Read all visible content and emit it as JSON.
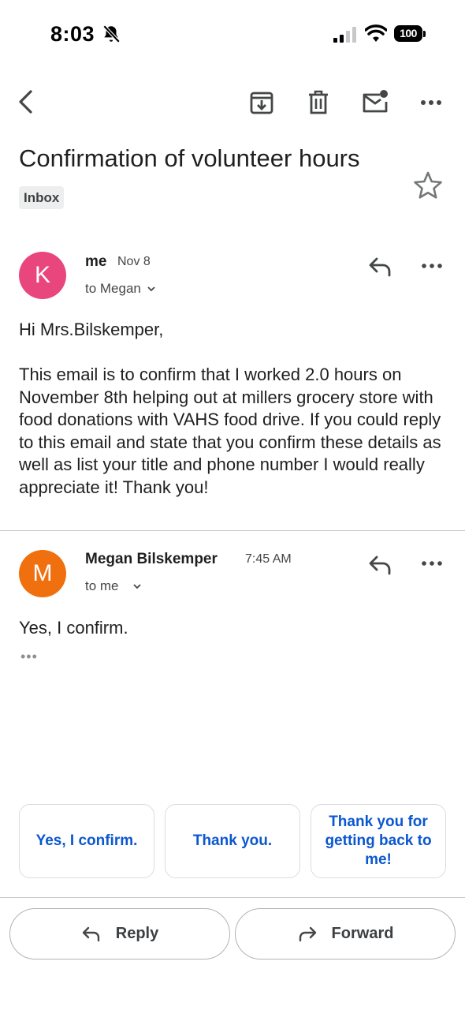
{
  "status_bar": {
    "time": "8:03",
    "battery": "100"
  },
  "toolbar": {
    "back_icon": "chevron-left-icon",
    "archive_icon": "archive-icon",
    "delete_icon": "trash-icon",
    "mark_unread_icon": "mark-unread-icon",
    "more_icon": "more-horiz-icon"
  },
  "email": {
    "subject": "Confirmation of volunteer hours",
    "label": "Inbox"
  },
  "messages": [
    {
      "avatar_letter": "K",
      "avatar_color": "#e8467c",
      "sender": "me",
      "date": "Nov 8",
      "to": "to Megan",
      "greeting": "Hi Mrs.Bilskemper,",
      "body": "This email is to confirm that I worked 2.0 hours on November 8th helping out at millers grocery store with food donations with VAHS food drive. If you could reply to this email and state that you confirm these details as well as list your title and phone number I would really appreciate it! Thank you!"
    },
    {
      "avatar_letter": "M",
      "avatar_color": "#f06f0e",
      "sender": "Megan Bilskemper",
      "date": "7:45 AM",
      "to": "to me",
      "body": "Yes, I confirm.",
      "trimmed": "•••"
    }
  ],
  "smart_replies": [
    "Yes, I confirm.",
    "Thank you.",
    "Thank you for getting back to me!"
  ],
  "actions": {
    "reply_label": "Reply",
    "forward_label": "Forward"
  },
  "colors": {
    "link_blue": "#0b57d0"
  }
}
